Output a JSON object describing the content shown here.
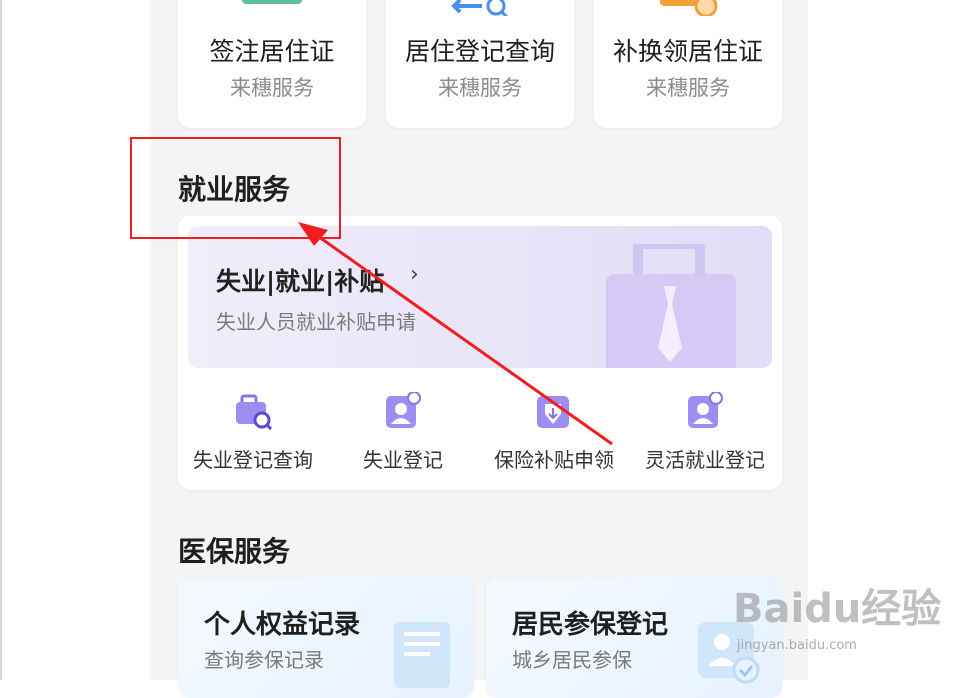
{
  "top_services": [
    {
      "title": "签注居住证",
      "subtitle": "来穗服务"
    },
    {
      "title": "居住登记查询",
      "subtitle": "来穗服务"
    },
    {
      "title": "补换领居住证",
      "subtitle": "来穗服务"
    }
  ],
  "employment": {
    "heading": "就业服务",
    "banner_title": "失业|就业|补贴",
    "banner_chevron": "›",
    "banner_subtitle": "失业人员就业补贴申请",
    "items": [
      {
        "label": "失业登记查询",
        "icon": "briefcase-search-icon"
      },
      {
        "label": "失业登记",
        "icon": "person-register-icon"
      },
      {
        "label": "保险补贴申领",
        "icon": "shield-subsidy-icon"
      },
      {
        "label": "灵活就业登记",
        "icon": "person-register-icon"
      }
    ]
  },
  "medical": {
    "heading": "医保服务",
    "cards": [
      {
        "title": "个人权益记录",
        "subtitle": "查询参保记录"
      },
      {
        "title": "居民参保登记",
        "subtitle": "城乡居民参保"
      }
    ]
  },
  "watermark": {
    "brand": "Baidu经验",
    "url": "jingyan.baidu.com"
  },
  "colors": {
    "highlight": "#f01e1e",
    "accent_purple": "#8a73e6"
  }
}
